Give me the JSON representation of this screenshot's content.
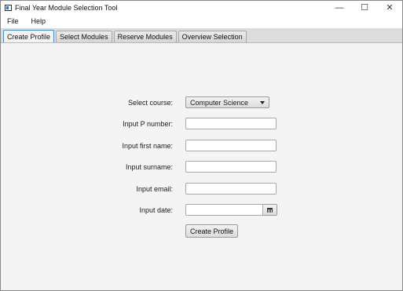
{
  "window": {
    "title": "Final Year Module Selection Tool",
    "controls": {
      "minimize": "—",
      "maximize": "☐",
      "close": "✕"
    }
  },
  "menu": {
    "items": [
      "File",
      "Help"
    ]
  },
  "tabs": [
    {
      "label": "Create Profile",
      "active": true
    },
    {
      "label": "Select Modules",
      "active": false
    },
    {
      "label": "Reserve Modules",
      "active": false
    },
    {
      "label": "Overview Selection",
      "active": false
    }
  ],
  "form": {
    "course_label": "Select course:",
    "course_value": "Computer Science",
    "pnumber_label": "Input P number:",
    "pnumber_value": "",
    "firstname_label": "Input first name:",
    "firstname_value": "",
    "surname_label": "Input surname:",
    "surname_value": "",
    "email_label": "Input email:",
    "email_value": "",
    "date_label": "Input date:",
    "date_value": "",
    "submit_label": "Create Profile"
  },
  "icons": {
    "app": "app-window-icon",
    "calendar": "calendar-icon",
    "dropdown": "chevron-down-icon"
  },
  "colors": {
    "active_tab_border": "#3c8fd6",
    "background": "#f4f4f4"
  }
}
